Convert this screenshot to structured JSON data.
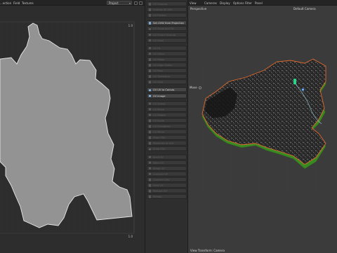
{
  "uv_editor": {
    "menu": [
      "...ection",
      "Field",
      "Textures"
    ],
    "dropdown_value": "Project",
    "corner_labels": {
      "top_right": "1.0",
      "bottom_right": "1.0"
    }
  },
  "tools_panel": {
    "groups": [
      {
        "items": [
          {
            "label": "UV Unwrap",
            "active": false
          },
          {
            "label": "Unwrap All UVs",
            "active": false
          },
          {
            "label": "UV Flatten",
            "active": false
          }
        ]
      },
      {
        "items": [
          {
            "label": "Set UVW from Projection",
            "active": true
          },
          {
            "label": "UV Scale and Fit",
            "active": false
          },
          {
            "label": "UV Smart Unwrap",
            "active": false
          },
          {
            "label": "UV Shell",
            "active": false
          }
        ]
      },
      {
        "items": [
          {
            "label": "UV Fit",
            "active": false
          },
          {
            "label": "UV Stitch",
            "active": false
          },
          {
            "label": "UV Relax",
            "active": false
          },
          {
            "label": "UV Align Shells",
            "active": false
          },
          {
            "label": "UV Pack",
            "active": false
          },
          {
            "label": "UV Transform",
            "active": false
          },
          {
            "label": "UV Grid",
            "active": false
          }
        ]
      },
      {
        "items": [
          {
            "label": "UV UV to Canvas",
            "active": true
          },
          {
            "label": "UV Image",
            "active": true
          }
        ]
      },
      {
        "items": [
          {
            "label": "UV Select",
            "active": false
          },
          {
            "label": "UV Move",
            "active": false
          },
          {
            "label": "UV Rotate",
            "active": false
          },
          {
            "label": "UV Scale",
            "active": false
          },
          {
            "label": "UV Straighten",
            "active": false
          },
          {
            "label": "UV Mirror",
            "active": false
          },
          {
            "label": "Align UVs",
            "active": false
          },
          {
            "label": "Rasterize to UVs",
            "active": false
          },
          {
            "label": "Snap UVs",
            "active": false
          }
        ]
      },
      {
        "items": [
          {
            "label": "Shell UV",
            "active": false
          },
          {
            "label": "Weld UV",
            "active": false
          },
          {
            "label": "Break UV",
            "active": false
          },
          {
            "label": "Connect UV",
            "active": false
          },
          {
            "label": "Connect UVs",
            "active": false
          },
          {
            "label": "Zero UV",
            "active": false
          },
          {
            "label": "Restore UV",
            "active": false
          },
          {
            "label": "Remap",
            "active": false
          }
        ]
      }
    ]
  },
  "viewport": {
    "menu": [
      "View",
      "Cameras",
      "Display",
      "Options",
      "Filter",
      "Panel"
    ],
    "view_label": "Perspective",
    "camera_label": "Default Camera",
    "tool_label": "Move",
    "status_label": "View Transform: Camera",
    "colors": {
      "outline": "#e06a2e",
      "base": "#3a8a22",
      "map": "#1f1f1f"
    }
  }
}
